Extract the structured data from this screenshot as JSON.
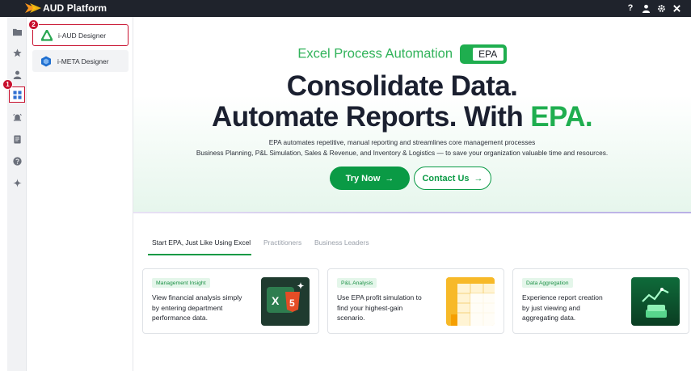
{
  "app": {
    "title": "AUD Platform"
  },
  "titlebar": {
    "help_symbol": "?"
  },
  "rail": {
    "items": [
      "folder-icon",
      "star-icon",
      "user-icon",
      "grid-icon",
      "alarm-icon",
      "document-icon",
      "help-icon",
      "sparkle-icon"
    ],
    "active_index": 3,
    "badge": "1"
  },
  "panel": {
    "badge": "2",
    "items": [
      {
        "label": "i-AUD Designer",
        "icon": "aud-designer-icon",
        "highlighted": true
      },
      {
        "label": "i-META Designer",
        "icon": "meta-designer-icon",
        "highlighted": false
      }
    ]
  },
  "hero": {
    "eyebrow": "Excel Process Automation",
    "tag": "EPA",
    "headline_line1": "Consolidate Data.",
    "headline_line2_prefix": "Automate Reports. With ",
    "headline_line2_accent": "EPA.",
    "desc_line1": "EPA automates repetitive, manual reporting and streamlines core management processes",
    "desc_line2": "Business Planning, P&L Simulation, Sales & Revenue, and Inventory & Logistics — to save your organization valuable time and resources.",
    "try_label": "Try Now",
    "contact_label": "Contact Us",
    "arrow": "→"
  },
  "tabs": [
    {
      "label": "Start EPA, Just Like Using Excel",
      "active": true
    },
    {
      "label": "Practitioners",
      "active": false
    },
    {
      "label": "Business Leaders",
      "active": false
    }
  ],
  "cards": [
    {
      "tag": "Management Insight",
      "line1": "View financial analysis simply",
      "line2": "by entering department",
      "line3": "performance data.",
      "art": "excel-html5-art"
    },
    {
      "tag": "P&L Analysis",
      "line1": "Use EPA profit simulation to",
      "line2": "find your highest-gain",
      "line3": "scenario.",
      "art": "spreadsheet-grid-art"
    },
    {
      "tag": "Data Aggregation",
      "line1": "Experience report creation",
      "line2": "by just viewing and",
      "line3": "aggregating data.",
      "art": "chart-stack-art"
    }
  ],
  "colors": {
    "accent_green": "#0a9a45",
    "eyebrow_green": "#32b35b",
    "highlight_red": "#c8102e",
    "titlebar": "#1f232c"
  }
}
